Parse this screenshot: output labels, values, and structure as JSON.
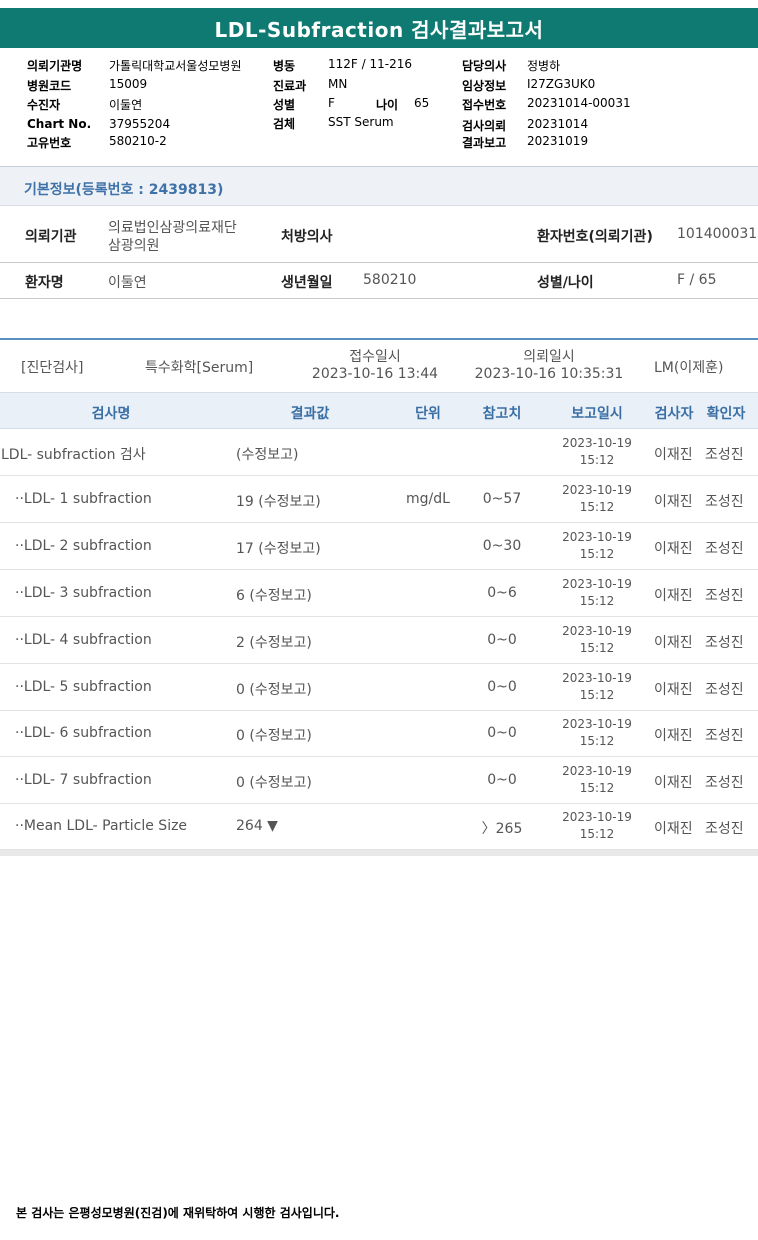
{
  "title": "LDL-Subfraction 검사결과보고서",
  "header": {
    "col1": [
      {
        "label": "의뢰기관명",
        "value": "가톨릭대학교서울성모병원"
      },
      {
        "label": "병원코드",
        "value": "15009"
      },
      {
        "label": "수진자",
        "value": "이둘연"
      },
      {
        "label": "Chart No.",
        "value": "37955204"
      },
      {
        "label": "고유번호",
        "value": "580210-2"
      }
    ],
    "col2": [
      {
        "label": "병동",
        "value": "112F / 11-216"
      },
      {
        "label": "진료과",
        "value": "MN"
      },
      {
        "label": "성별",
        "value": "F"
      },
      {
        "label": "검체",
        "value": "SST Serum"
      }
    ],
    "age": {
      "label": "나이",
      "value": "65"
    },
    "col3": [
      {
        "label": "담당의사",
        "value": "정병하"
      },
      {
        "label": "임상정보",
        "value": "I27ZG3UK0"
      },
      {
        "label": "접수번호",
        "value": "20231014-00031"
      },
      {
        "label": "검사의뢰",
        "value": "20231014"
      },
      {
        "label": "결과보고",
        "value": "20231019"
      }
    ]
  },
  "basic_info": {
    "title": "기본정보(등록번호 : 2439813)",
    "referral_org_label": "의뢰기관",
    "referral_org_line1": "의료법인삼광의료재단",
    "referral_org_line2": "삼광의원",
    "doctor_label": "처방의사",
    "doctor_value": "",
    "patient_no_label": "환자번호(의뢰기관)",
    "patient_no_value": "101400031",
    "patient_name_label": "환자명",
    "patient_name_value": "이둘연",
    "dob_label": "생년월일",
    "dob_value": "580210",
    "sex_age_label": "성별/나이",
    "sex_age_value": "F / 65"
  },
  "exam_meta": {
    "category": "[진단검사]",
    "specimen": "특수화학[Serum]",
    "received_label": "접수일시",
    "received_value": "2023-10-16 13:44",
    "requested_label": "의뢰일시",
    "requested_value": "2023-10-16 10:35:31",
    "lab": "LM(이제훈)"
  },
  "table": {
    "headers": {
      "name": "검사명",
      "result": "결과값",
      "unit": "단위",
      "ref": "참고치",
      "date": "보고일시",
      "tester": "검사자",
      "confirmer": "확인자"
    },
    "rows": [
      {
        "name": "LDL- subfraction 검사",
        "result": "(수정보고)",
        "unit": "",
        "ref": "",
        "date1": "2023-10-19",
        "date2": "15:12",
        "tester": "이재진",
        "confirmer": "조성진"
      },
      {
        "name": "··LDL- 1 subfraction",
        "result": "19 (수정보고)",
        "unit": "mg/dL",
        "ref": "0~57",
        "date1": "2023-10-19",
        "date2": "15:12",
        "tester": "이재진",
        "confirmer": "조성진"
      },
      {
        "name": "··LDL- 2 subfraction",
        "result": "17 (수정보고)",
        "unit": "",
        "ref": "0~30",
        "date1": "2023-10-19",
        "date2": "15:12",
        "tester": "이재진",
        "confirmer": "조성진"
      },
      {
        "name": "··LDL- 3 subfraction",
        "result": "6 (수정보고)",
        "unit": "",
        "ref": "0~6",
        "date1": "2023-10-19",
        "date2": "15:12",
        "tester": "이재진",
        "confirmer": "조성진"
      },
      {
        "name": "··LDL- 4 subfraction",
        "result": "2 (수정보고)",
        "unit": "",
        "ref": "0~0",
        "date1": "2023-10-19",
        "date2": "15:12",
        "tester": "이재진",
        "confirmer": "조성진"
      },
      {
        "name": "··LDL- 5 subfraction",
        "result": "0 (수정보고)",
        "unit": "",
        "ref": "0~0",
        "date1": "2023-10-19",
        "date2": "15:12",
        "tester": "이재진",
        "confirmer": "조성진"
      },
      {
        "name": "··LDL- 6 subfraction",
        "result": "0 (수정보고)",
        "unit": "",
        "ref": "0~0",
        "date1": "2023-10-19",
        "date2": "15:12",
        "tester": "이재진",
        "confirmer": "조성진"
      },
      {
        "name": "··LDL- 7 subfraction",
        "result": "0 (수정보고)",
        "unit": "",
        "ref": "0~0",
        "date1": "2023-10-19",
        "date2": "15:12",
        "tester": "이재진",
        "confirmer": "조성진"
      },
      {
        "name": "··Mean LDL- Particle Size",
        "result": "264 ▼",
        "unit": "",
        "ref": "〉265",
        "date1": "2023-10-19",
        "date2": "15:12",
        "tester": "이재진",
        "confirmer": "조성진"
      }
    ]
  },
  "footer_note": "본 검사는 은평성모병원(진검)에 재위탁하여 시행한 검사입니다."
}
